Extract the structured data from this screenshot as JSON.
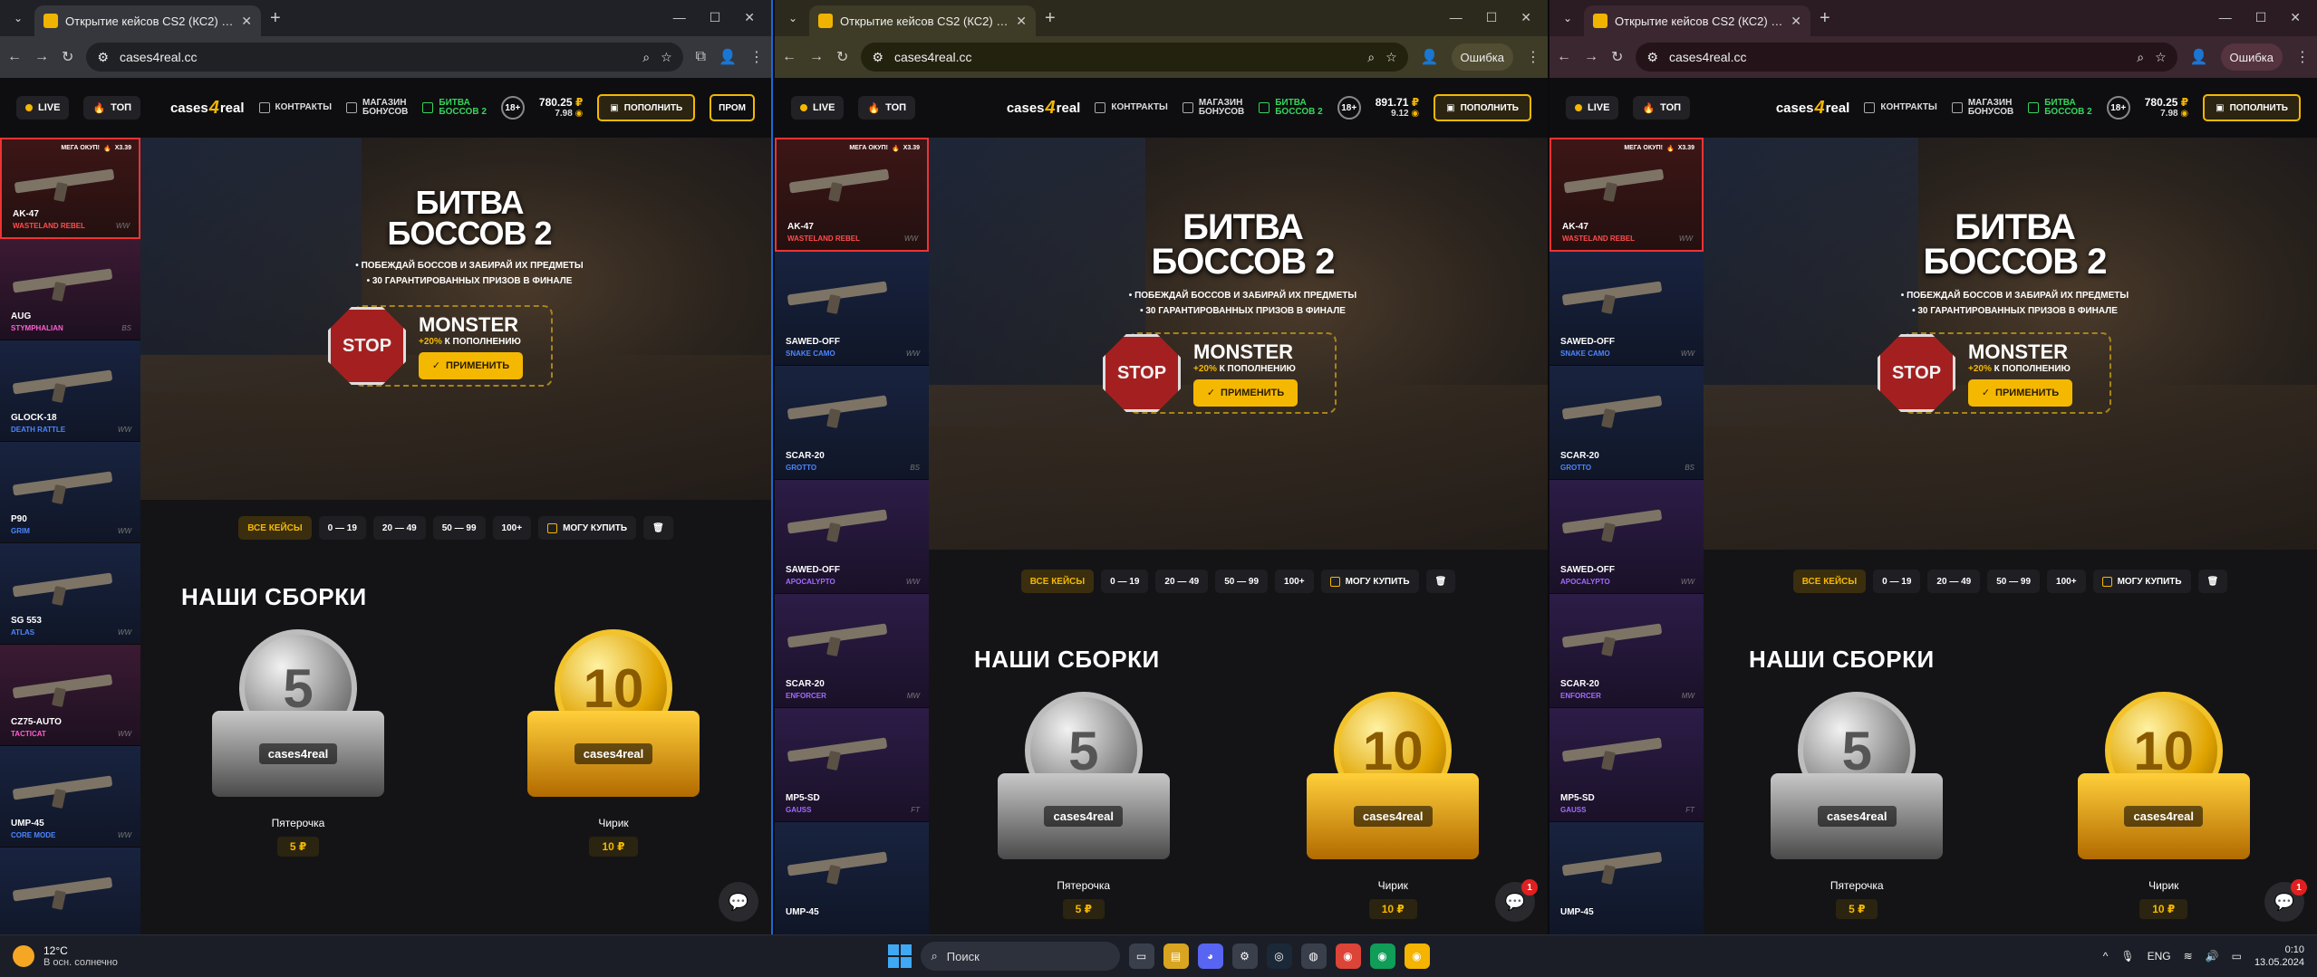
{
  "tab_title": "Открытие кейсов CS2 (КС2) - …",
  "url": "cases4real.cc",
  "error_label": "Ошибка",
  "site": {
    "live": "LIVE",
    "top": "ТОП",
    "logo_a": "cases",
    "logo_4": "4",
    "logo_b": "real",
    "contracts": "КОНТРАКТЫ",
    "bonus_shop_1": "МАГАЗИН",
    "bonus_shop_2": "БОНУСОВ",
    "battle_1": "БИТВА",
    "battle_2": "БОССОВ 2",
    "age": "18+",
    "deposit": "ПОПОЛНИТЬ",
    "promo": "ПРОМ"
  },
  "windows": [
    {
      "balance": "780.25",
      "sub_balance": "7.98"
    },
    {
      "balance": "891.71",
      "sub_balance": "9.12"
    },
    {
      "balance": "780.25",
      "sub_balance": "7.98"
    }
  ],
  "rub_symbol": "₽",
  "banner": {
    "title_1": "БИТВА",
    "title_2": "БОССОВ 2",
    "bullet_1": "ПОБЕЖДАЙ БОССОВ И ЗАБИРАЙ ИХ ПРЕДМЕТЫ",
    "bullet_2": "30 ГАРАНТИРОВАННЫХ ПРИЗОВ В ФИНАЛЕ",
    "stop": "STOP",
    "bonus_name": "MONSTER",
    "bonus_pct": "+20%",
    "bonus_sub": "К ПОПОЛНЕНИЮ",
    "apply": "ПРИМЕНИТЬ"
  },
  "filters": {
    "all": "ВСЕ КЕЙСЫ",
    "f1": "0 — 19",
    "f2": "20 — 49",
    "f3": "50 — 99",
    "f4": "100+",
    "can_buy": "МОГУ КУПИТЬ"
  },
  "section_title": "НАШИ СБОРКИ",
  "cases": [
    {
      "num": "5",
      "brand": "cases4real",
      "name": "Пятерочка",
      "price": "5 ₽"
    },
    {
      "num": "10",
      "brand": "cases4real",
      "name": "Чирик",
      "price": "10 ₽"
    }
  ],
  "chat_badge": "1",
  "mega": {
    "label": "МЕГА ОКУП!",
    "mult": "X3.39"
  },
  "feed_w1": [
    {
      "gun": "AK-47",
      "skin": "WASTELAND REBEL",
      "wear": "WW",
      "rarity": "red"
    },
    {
      "gun": "AUG",
      "skin": "STYMPHALIAN",
      "wear": "BS",
      "rarity": "pink"
    },
    {
      "gun": "GLOCK-18",
      "skin": "DEATH RATTLE",
      "wear": "WW",
      "rarity": "blue"
    },
    {
      "gun": "P90",
      "skin": "GRIM",
      "wear": "WW",
      "rarity": "blue"
    },
    {
      "gun": "SG 553",
      "skin": "ATLAS",
      "wear": "WW",
      "rarity": "blue"
    },
    {
      "gun": "CZ75-AUTO",
      "skin": "TACTICAT",
      "wear": "WW",
      "rarity": "pink"
    },
    {
      "gun": "UMP-45",
      "skin": "CORE MODE",
      "wear": "WW",
      "rarity": "blue"
    },
    {
      "gun": "",
      "skin": "",
      "wear": "",
      "rarity": "blue"
    }
  ],
  "feed_w23": [
    {
      "gun": "AK-47",
      "skin": "WASTELAND REBEL",
      "wear": "WW",
      "rarity": "red"
    },
    {
      "gun": "SAWED-OFF",
      "skin": "SNAKE CAMO",
      "wear": "WW",
      "rarity": "blue"
    },
    {
      "gun": "SCAR-20",
      "skin": "GROTTO",
      "wear": "BS",
      "rarity": "blue"
    },
    {
      "gun": "SAWED-OFF",
      "skin": "APOCALYPTO",
      "wear": "WW",
      "rarity": "purple"
    },
    {
      "gun": "SCAR-20",
      "skin": "ENFORCER",
      "wear": "MW",
      "rarity": "purple"
    },
    {
      "gun": "MP5-SD",
      "skin": "GAUSS",
      "wear": "FT",
      "rarity": "purple"
    },
    {
      "gun": "UMP-45",
      "skin": "",
      "wear": "",
      "rarity": "blue"
    }
  ],
  "taskbar": {
    "temp": "12°C",
    "weather": "В осн. солнечно",
    "search": "Поиск",
    "lang": "ENG",
    "time": "0:10",
    "date": "13.05.2024"
  }
}
